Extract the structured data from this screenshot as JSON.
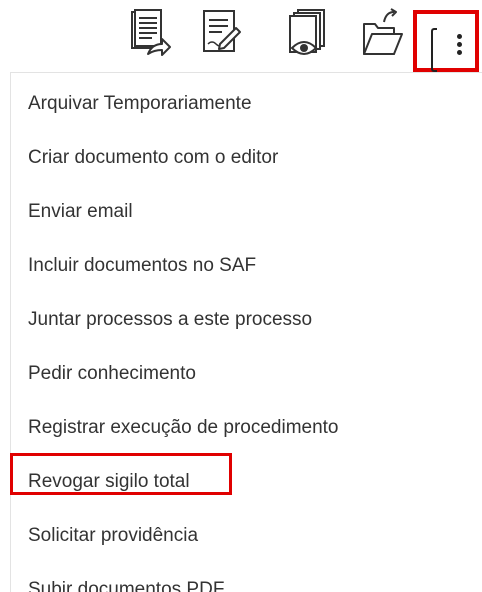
{
  "toolbar": {
    "icons": [
      {
        "name": "send-document-icon"
      },
      {
        "name": "edit-document-icon"
      },
      {
        "name": "view-document-icon"
      },
      {
        "name": "open-folder-icon"
      }
    ],
    "more_button": {
      "icon": "more-vertical-icon"
    }
  },
  "menu": {
    "items": [
      {
        "label": "Arquivar Temporariamente"
      },
      {
        "label": "Criar documento com o editor"
      },
      {
        "label": "Enviar email"
      },
      {
        "label": "Incluir documentos no SAF"
      },
      {
        "label": "Juntar processos a este processo"
      },
      {
        "label": "Pedir conhecimento"
      },
      {
        "label": "Registrar execução de procedimento"
      },
      {
        "label": "Revogar sigilo total"
      },
      {
        "label": "Solicitar providência"
      },
      {
        "label": "Subir documentos PDF"
      }
    ]
  },
  "colors": {
    "highlight": "#e00000",
    "text": "#333333",
    "icon_stroke": "#333333"
  }
}
